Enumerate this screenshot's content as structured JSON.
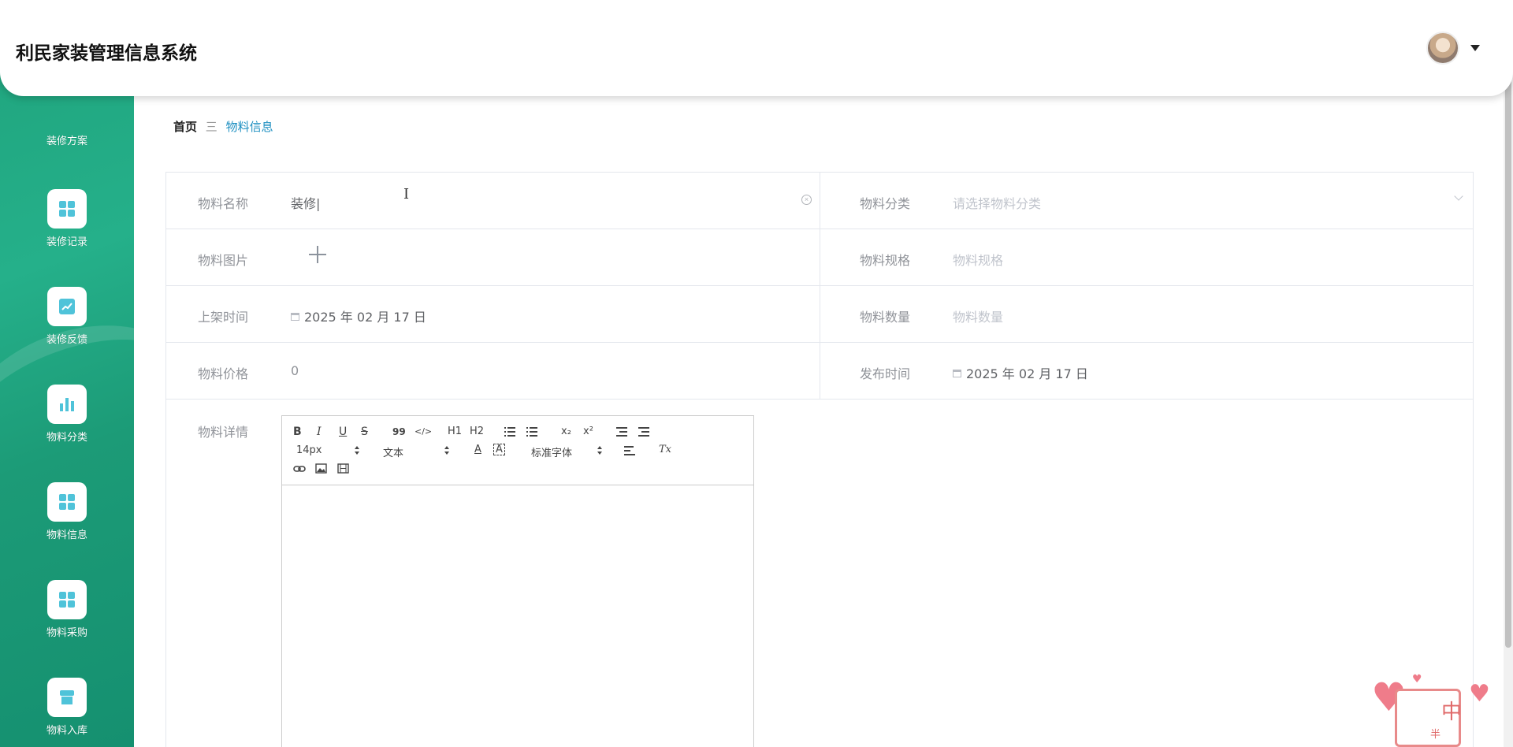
{
  "header": {
    "app_title": "利民家装管理信息系统"
  },
  "sidebar": {
    "items": [
      {
        "label": "装修方案",
        "icon": "none"
      },
      {
        "label": "装修记录",
        "icon": "grid-icon"
      },
      {
        "label": "装修反馈",
        "icon": "line-chart-icon"
      },
      {
        "label": "物料分类",
        "icon": "bar-chart-icon"
      },
      {
        "label": "物料信息",
        "icon": "grid-icon"
      },
      {
        "label": "物料采购",
        "icon": "grid-icon"
      },
      {
        "label": "物料入库",
        "icon": "store-icon"
      }
    ],
    "accent_color": "#1fa37c"
  },
  "breadcrumb": {
    "home": "首页",
    "separator": "三",
    "current": "物料信息"
  },
  "form": {
    "name": {
      "label": "物料名称",
      "value": "装修|"
    },
    "category": {
      "label": "物料分类",
      "placeholder": "请选择物料分类"
    },
    "image": {
      "label": "物料图片"
    },
    "spec": {
      "label": "物料规格",
      "placeholder": "物料规格"
    },
    "shelf_time": {
      "label": "上架时间",
      "value": "2025 年 02 月 17 日"
    },
    "quantity": {
      "label": "物料数量",
      "placeholder": "物料数量"
    },
    "price": {
      "label": "物料价格",
      "value": "0"
    },
    "publish_time": {
      "label": "发布时间",
      "value": "2025 年 02 月 17 日"
    },
    "detail": {
      "label": "物料详情"
    }
  },
  "editor": {
    "bold": "B",
    "italic": "I",
    "underline": "U",
    "strike": "S",
    "quote": "99",
    "code": "</>",
    "h1": "H1",
    "h2": "H2",
    "sub": "x₂",
    "sup": "x²",
    "size": "14px",
    "header": "文本",
    "font_color": "A",
    "font": "标准字体",
    "clean": "Tx"
  },
  "stamp": {
    "char": "中",
    "sub": "半"
  }
}
